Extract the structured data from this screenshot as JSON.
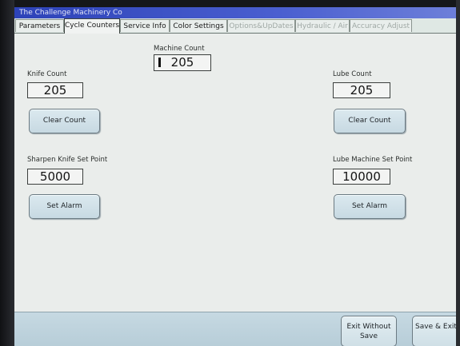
{
  "window": {
    "title": "The Challenge Machinery Co"
  },
  "tabs": [
    {
      "label": "Parameters",
      "state": "normal"
    },
    {
      "label": "Cycle Counters",
      "state": "active"
    },
    {
      "label": "Service Info",
      "state": "normal"
    },
    {
      "label": "Color Settings",
      "state": "normal"
    },
    {
      "label": "Options&UpDates",
      "state": "disabled"
    },
    {
      "label": "Hydraulic / Air",
      "state": "disabled"
    },
    {
      "label": "Accuracy Adjust",
      "state": "disabled"
    }
  ],
  "machine_count": {
    "label": "Machine Count",
    "value": "205"
  },
  "knife": {
    "count_label": "Knife Count",
    "count_value": "205",
    "clear_label": "Clear Count",
    "setpoint_label": "Sharpen Knife Set Point",
    "setpoint_value": "5000",
    "alarm_label": "Set Alarm"
  },
  "lube": {
    "count_label": "Lube Count",
    "count_value": "205",
    "clear_label": "Clear Count",
    "setpoint_label": "Lube Machine Set Point",
    "setpoint_value": "10000",
    "alarm_label": "Set Alarm"
  },
  "footer": {
    "exit_line1": "Exit",
    "exit_line2": "Without Save",
    "save_line1": "Save &",
    "save_line2": "Exit"
  }
}
